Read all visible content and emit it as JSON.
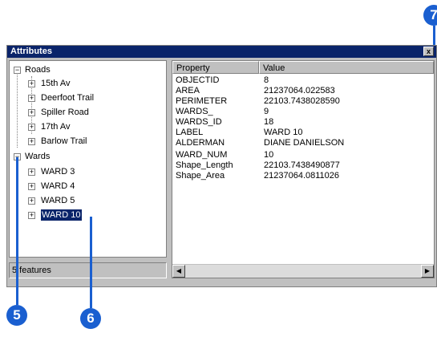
{
  "callouts": {
    "c5": "5",
    "c6": "6",
    "c7": "7"
  },
  "window": {
    "title": "Attributes",
    "close_glyph": "x"
  },
  "tree": {
    "roads": {
      "label": "Roads",
      "children": [
        "15th Av",
        "Deerfoot Trail",
        "Spiller Road",
        "17th Av",
        "Barlow Trail"
      ]
    },
    "wards": {
      "label": "Wards",
      "children": [
        "WARD 3",
        "WARD 4",
        "WARD 5",
        "WARD 10"
      ],
      "selected": "WARD 10"
    }
  },
  "status": {
    "text": "5 features"
  },
  "table": {
    "headers": {
      "property": "Property",
      "value": "Value"
    },
    "rows": [
      {
        "property": "OBJECTID",
        "value": "8"
      },
      {
        "property": "AREA",
        "value": "21237064.022583"
      },
      {
        "property": "PERIMETER",
        "value": "22103.7438028590"
      },
      {
        "property": "WARDS_",
        "value": "9"
      },
      {
        "property": "WARDS_ID",
        "value": "18"
      },
      {
        "property": "LABEL",
        "value": "WARD 10"
      },
      {
        "property": "ALDERMAN",
        "value": "DIANE DANIELSON"
      },
      {
        "property": "WARD_NUM",
        "value": "10"
      },
      {
        "property": "Shape_Length",
        "value": "22103.7438490877"
      },
      {
        "property": "Shape_Area",
        "value": "21237064.0811026"
      }
    ]
  },
  "icons": {
    "expand": "plus-box-icon",
    "collapse": "minus-box-icon",
    "scroll_left": "arrow-left-icon",
    "scroll_right": "arrow-right-icon"
  },
  "colors": {
    "callout": "#1a5fd0",
    "titlebar": "#0a246a",
    "selection": "#0a246a"
  }
}
